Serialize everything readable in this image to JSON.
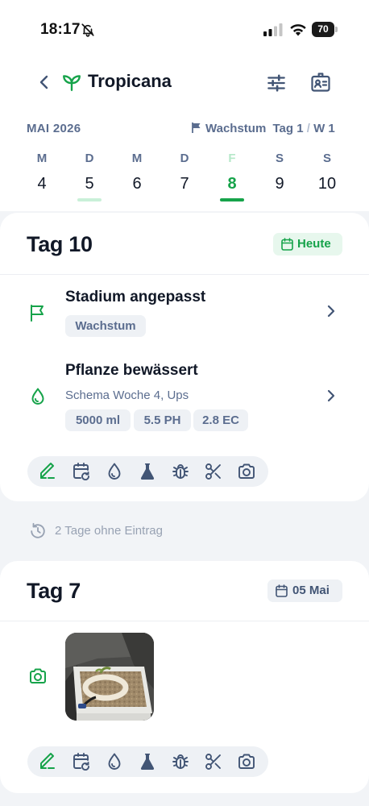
{
  "status_bar": {
    "time": "18:17",
    "battery": "70"
  },
  "header": {
    "title": "Tropicana"
  },
  "calendar": {
    "month": "MAI 2026",
    "stage": "Wachstum",
    "day_label": "Tag 1",
    "separator": "/",
    "week_label": "W 1",
    "days": [
      {
        "letter": "M",
        "number": "4"
      },
      {
        "letter": "D",
        "number": "5"
      },
      {
        "letter": "M",
        "number": "6"
      },
      {
        "letter": "D",
        "number": "7"
      },
      {
        "letter": "F",
        "number": "8"
      },
      {
        "letter": "S",
        "number": "9"
      },
      {
        "letter": "S",
        "number": "10"
      }
    ]
  },
  "day_cards": [
    {
      "title": "Tag 10",
      "badge": "Heute",
      "entries": [
        {
          "title": "Stadium angepasst",
          "chips": [
            "Wachstum"
          ]
        },
        {
          "title": "Pflanze bewässert",
          "subtitle": "Schema Woche 4, Ups",
          "chips": [
            "5000 ml",
            "5.5 PH",
            "2.8 EC"
          ]
        }
      ]
    },
    {
      "title": "Tag 7",
      "badge": "05 Mai"
    }
  ],
  "gap_note": "2 Tage ohne Eintrag",
  "colors": {
    "accent": "#16a34a",
    "muted": "#5b6d8f",
    "chip_bg": "#eef1f5",
    "page_bg": "#f2f4f7"
  },
  "icons": {
    "actions": [
      "edit-note-icon",
      "calendar-repeat-icon",
      "water-drop-icon",
      "flask-icon",
      "bug-icon",
      "scissors-icon",
      "camera-icon"
    ]
  }
}
